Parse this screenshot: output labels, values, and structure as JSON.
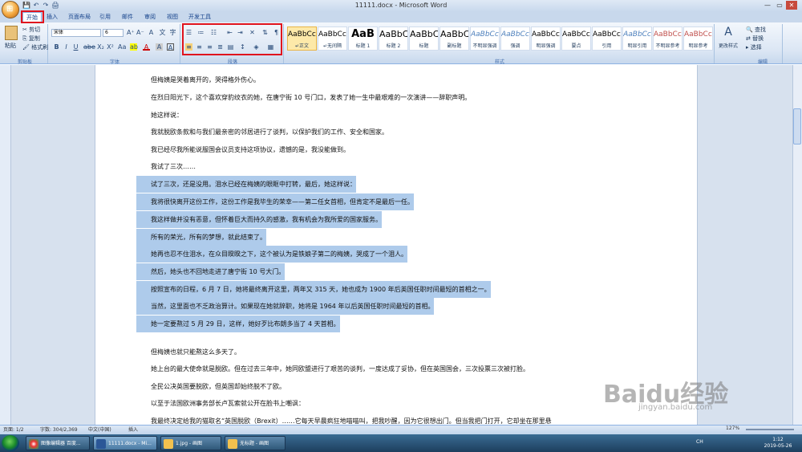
{
  "window": {
    "title": "11111.docx - Microsoft Word",
    "min": "—",
    "max": "▭",
    "close": "✕"
  },
  "qat": {
    "save": "💾",
    "undo": "↶",
    "redo": "↷",
    "print": "🖨"
  },
  "tabs": [
    "开始",
    "插入",
    "页面布局",
    "引用",
    "邮件",
    "审阅",
    "视图",
    "开发工具"
  ],
  "clipboard": {
    "paste": "粘贴",
    "cut": "剪切",
    "copy": "复制",
    "format_painter": "格式刷",
    "label": "剪贴板"
  },
  "font": {
    "name": "宋体",
    "size": "6",
    "label": "字体",
    "bold": "B",
    "italic": "I",
    "underline": "U",
    "strike": "abe",
    "sub": "X₂",
    "sup": "X²",
    "aa": "Aa",
    "grow": "A⁺",
    "shrink": "A⁻",
    "clear": "A",
    "color": "A",
    "highlight": "ab",
    "wen": "文",
    "circle": "字"
  },
  "paragraph": {
    "label": "段落"
  },
  "styles": {
    "label": "样式",
    "change": "更改样式",
    "items": [
      {
        "sample": "AaBbCcD",
        "name": "↵正文"
      },
      {
        "sample": "AaBbCcD",
        "name": "↵无间隔"
      },
      {
        "sample": "AaB",
        "name": "标题 1"
      },
      {
        "sample": "AaBbC",
        "name": "标题 2"
      },
      {
        "sample": "AaBbC",
        "name": "标题"
      },
      {
        "sample": "AaBbC",
        "name": "副标题"
      },
      {
        "sample": "AaBbCcDc",
        "name": "不明显强调"
      },
      {
        "sample": "AaBbCcDc",
        "name": "强调"
      },
      {
        "sample": "AaBbCcDc",
        "name": "明显强调"
      },
      {
        "sample": "AaBbCcDc",
        "name": "要点"
      },
      {
        "sample": "AaBbCcL",
        "name": "引用"
      },
      {
        "sample": "AaBbCc",
        "name": "明显引用"
      },
      {
        "sample": "AaBbCcD",
        "name": "不明显参考"
      },
      {
        "sample": "AaBbCcD",
        "name": "明显参考"
      }
    ]
  },
  "editing": {
    "find": "查找",
    "replace": "替换",
    "select": "选择",
    "label": "编辑"
  },
  "doc": {
    "lines": [
      {
        "text": "但梅姨是哭着离开的，哭得格外伤心。",
        "sel": false
      },
      {
        "text": "在烈日阳光下，这个喜欢穿豹纹衣的她，在唐宁街 10 号门口，发表了她一生中最艰难的一次演讲——辞职声明。",
        "sel": false
      },
      {
        "text": "她这样说：",
        "sel": false
      },
      {
        "text": "我就脱欧条款和与我们最亲密的邻居进行了谈判，以保护我们的工作、安全和国家。",
        "sel": false
      },
      {
        "text": "我已经尽我所能说服国会议员支持这项协议，遗憾的是，我没能做到。",
        "sel": false
      },
      {
        "text": "我试了三次……",
        "sel": false
      },
      {
        "text": "试了三次，还是没用。泪水已经在梅姨的眼眶中打转，最后，她这样说：",
        "sel": true
      },
      {
        "text": "我将很快离开这份工作，这份工作是我毕生的荣幸——第二任女首相，但肯定不是最后一任。",
        "sel": true
      },
      {
        "text": "我这样做并没有恶意，但怀着巨大而持久的感激，我有机会为我所爱的国家服务。",
        "sel": true
      },
      {
        "text": "所有的荣光，所有的梦想，就此结束了。",
        "sel": true
      },
      {
        "text": "她再也忍不住泪水，在众目睽睽之下，这个被认为是铁娘子第二的梅姨，哭成了一个泪人。",
        "sel": true
      },
      {
        "text": "然后，她头也不回地走进了唐宁街 10 号大门。",
        "sel": true
      },
      {
        "text": "按照宣布的日程，6 月 7 日，她将最终离开这里，两年又 315 天，她也成为 1900 年后英国任职时间最短的首相之一。",
        "sel": true
      },
      {
        "text": "当然，这里面也不乏政治算计。如果现在她就辞职，她将是 1964 年以后英国任职时间最短的首相。",
        "sel": true
      },
      {
        "text": "她一定要熬过 5 月 29 日，这样，她好歹比布朗多当了 4 天首相。",
        "sel": true
      },
      {
        "text": "但梅姨也就只能熬这么多天了。",
        "sel": false
      },
      {
        "text": "她上台的最大使命就是脱欧。但在过去三年中，她同欧盟进行了艰苦的谈判，一度达成了妥协，但在英国国会，三次投票三次被打脸。",
        "sel": false
      },
      {
        "text": "全民公决英国要脱欧，但英国却始终脱不了欧。",
        "sel": false
      },
      {
        "text": "以至于法国欧洲事务部长卢瓦索就公开在脸书上嘲讽：",
        "sel": false
      },
      {
        "text": "我最终决定给我的猫取名“英国脱欧（Brexit）……它每天早晨疯狂地喵喵叫，把我吵醒，因为它很想出门。但当我把门打开，它却坐在那里悬",
        "sel": false
      }
    ]
  },
  "status": {
    "page": "页面: 1/2",
    "words": "字数: 304/2,369",
    "lang": "中文(中国)",
    "mode": "插入",
    "zoom": "127%"
  },
  "taskbar": {
    "items": [
      "图像编辑器 百度...",
      "11111.docx - Mi...",
      "1.jpg - 画图",
      "无标题 - 画图"
    ],
    "time": "1:12",
    "date": "2019-05-26",
    "ime": "CH"
  },
  "watermark": {
    "brand": "Baidu经验",
    "url": "jingyan.baidu.com"
  }
}
